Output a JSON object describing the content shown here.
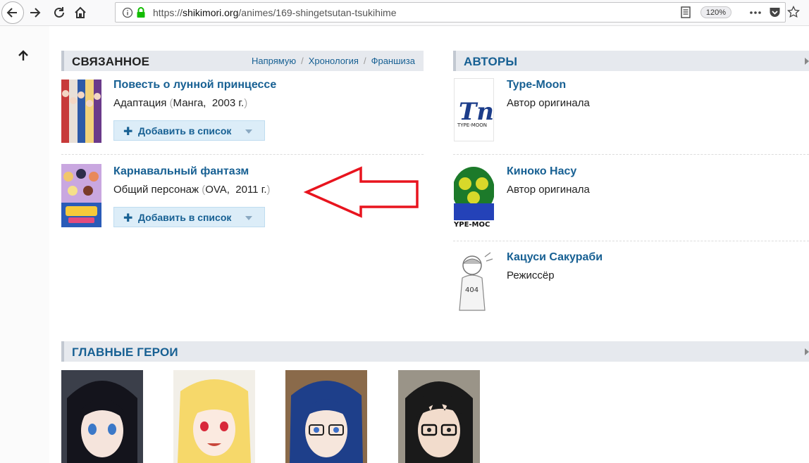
{
  "browser": {
    "url_prefix": "https://",
    "url_host": "shikimori.org",
    "url_path": "/animes/169-shingetsutan-tsukihime",
    "zoom": "120%"
  },
  "related": {
    "title": "СВЯЗАННОЕ",
    "tabs": [
      "Напрямую",
      "Хронология",
      "Франшиза"
    ],
    "tab_separator": "/",
    "items": [
      {
        "title": "Повесть о лунной принцессе",
        "relation": "Адаптация",
        "kind": "Манга,",
        "year": "2003 г.",
        "add_label": "Добавить в список"
      },
      {
        "title": "Карнавальный фантазм",
        "relation": "Общий персонаж",
        "kind": "OVA,",
        "year": "2011 г.",
        "add_label": "Добавить в список"
      }
    ],
    "paren_open": "(",
    "paren_close": ")"
  },
  "authors": {
    "title": "АВТОРЫ",
    "items": [
      {
        "name": "Type-Moon",
        "role": "Автор оригинала",
        "logo_text": "TYPE-MOON"
      },
      {
        "name": "Киноко Насу",
        "role": "Автор оригинала",
        "logo_text": "YPE-MOC"
      },
      {
        "name": "Кацуси Сакураби",
        "role": "Режиссёр",
        "shirt_text": "404"
      }
    ]
  },
  "heroes": {
    "title": "ГЛАВНЫЕ ГЕРОИ"
  },
  "colors": {
    "link": "#176093",
    "section_bg": "#e6e9ee",
    "button_bg": "#dcedf8",
    "annotation_arrow": "#e8141e"
  }
}
